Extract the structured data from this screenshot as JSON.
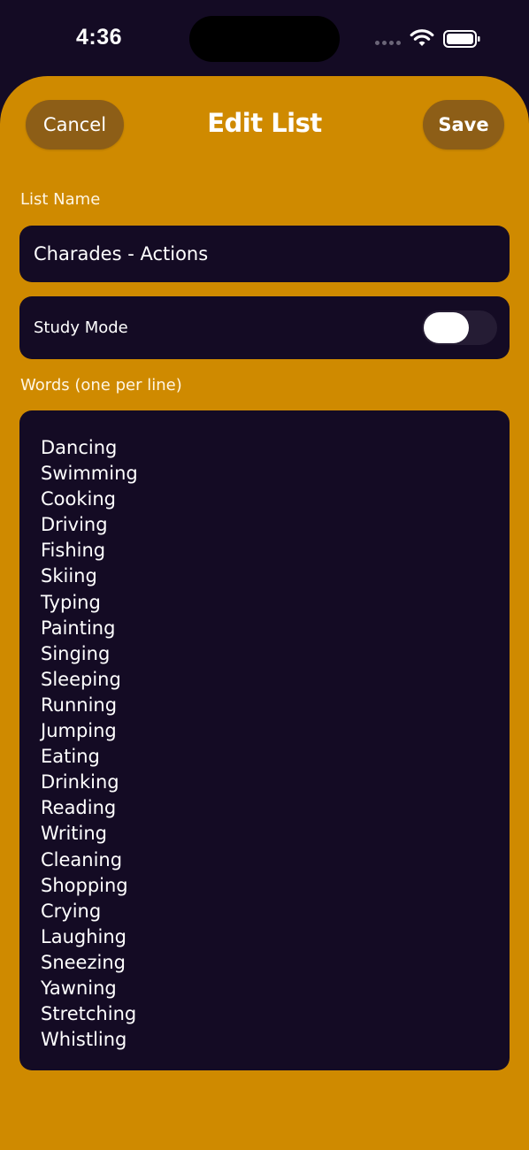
{
  "status_bar": {
    "time": "4:36"
  },
  "header": {
    "title": "Edit List",
    "cancel_label": "Cancel",
    "save_label": "Save"
  },
  "form": {
    "list_name_label": "List Name",
    "list_name_value": "Charades - Actions",
    "study_mode_label": "Study Mode",
    "study_mode_enabled": false,
    "words_label": "Words (one per line)",
    "words": [
      "Dancing",
      "Swimming",
      "Cooking",
      "Driving",
      "Fishing",
      "Skiing",
      "Typing",
      "Painting",
      "Singing",
      "Sleeping",
      "Running",
      "Jumping",
      "Eating",
      "Drinking",
      "Reading",
      "Writing",
      "Cleaning",
      "Shopping",
      "Crying",
      "Laughing",
      "Sneezing",
      "Yawning",
      "Stretching",
      "Whistling"
    ]
  },
  "colors": {
    "sheet": "#cf8a00",
    "card": "#140b24",
    "background": "#140b24"
  }
}
